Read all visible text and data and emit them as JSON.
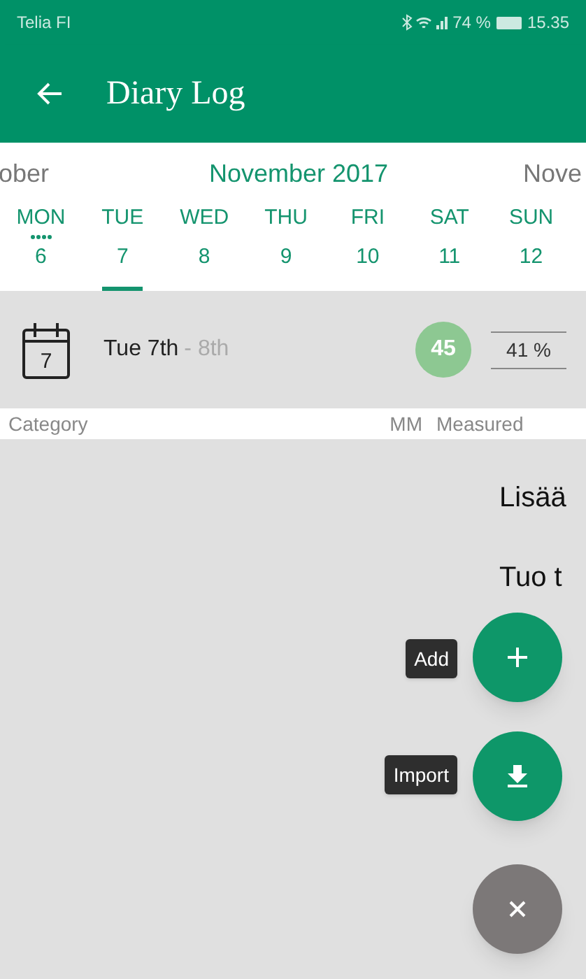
{
  "status_bar": {
    "carrier": "Telia FI",
    "battery_percent": "74 %",
    "time": "15.35"
  },
  "app_bar": {
    "title": "Diary Log"
  },
  "month_strip": {
    "previous": "ober",
    "current": "November 2017",
    "next": "Nove"
  },
  "days": [
    {
      "name": "MON",
      "number": "6",
      "selected": false,
      "has_entries": true
    },
    {
      "name": "TUE",
      "number": "7",
      "selected": true,
      "has_entries": false
    },
    {
      "name": "WED",
      "number": "8",
      "selected": false,
      "has_entries": false
    },
    {
      "name": "THU",
      "number": "9",
      "selected": false,
      "has_entries": false
    },
    {
      "name": "FRI",
      "number": "10",
      "selected": false,
      "has_entries": false
    },
    {
      "name": "SAT",
      "number": "11",
      "selected": false,
      "has_entries": false
    },
    {
      "name": "SUN",
      "number": "12",
      "selected": false,
      "has_entries": false
    }
  ],
  "summary": {
    "calendar_day": "7",
    "date": "Tue 7th",
    "range_end": "- 8th",
    "score": "45",
    "percent": "41 %"
  },
  "table": {
    "columns": [
      "Category",
      "MM",
      "Measured"
    ]
  },
  "background_texts": [
    "Lisää",
    "Tuo t"
  ],
  "fab_menu": [
    {
      "kind": "add",
      "label": "Add"
    },
    {
      "kind": "import",
      "label": "Import"
    },
    {
      "kind": "close"
    }
  ]
}
